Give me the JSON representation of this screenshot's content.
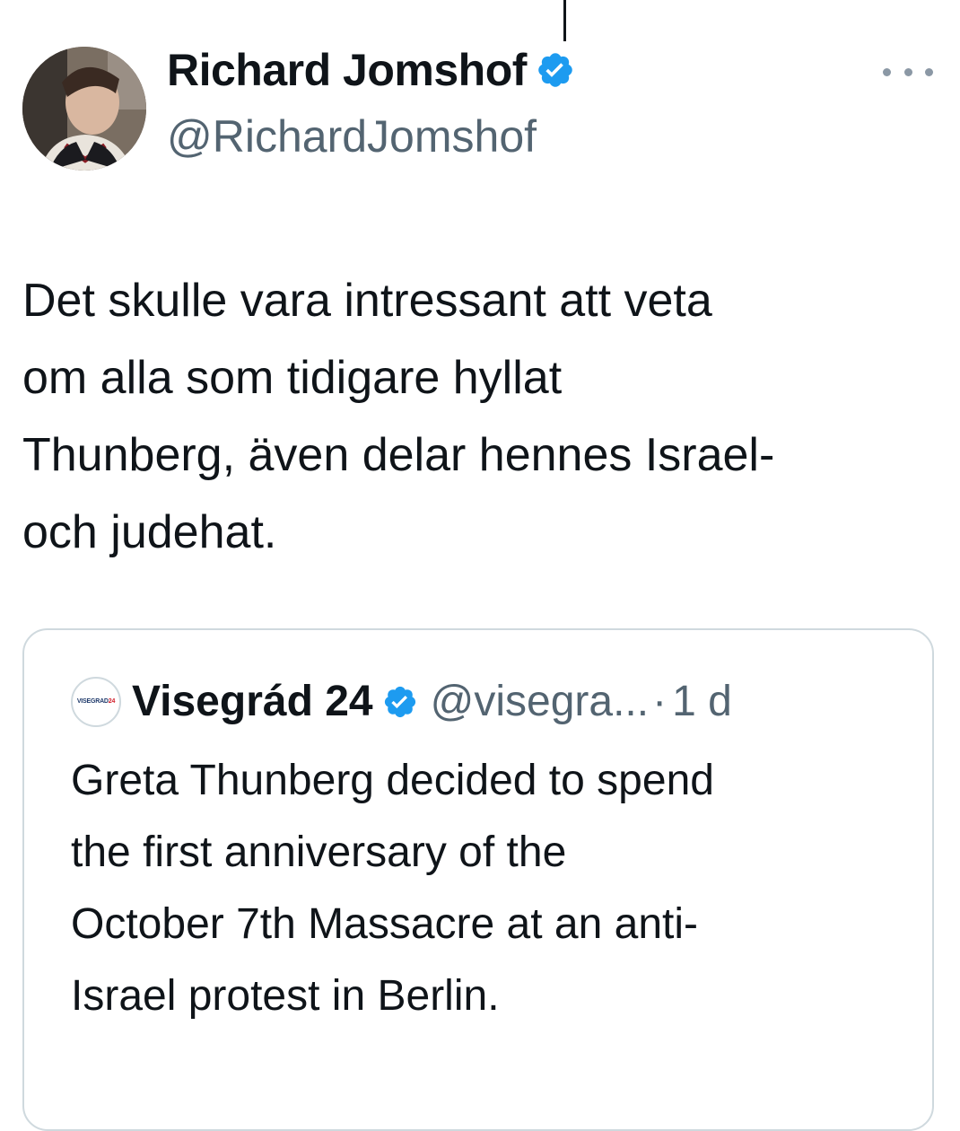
{
  "tweet": {
    "author": {
      "name": "Richard Jomshof",
      "handle": "@RichardJomshof",
      "verified": true,
      "verified_icon": "verified-badge-icon"
    },
    "more_icon": "more-options-icon",
    "text": "Det skulle vara intressant att veta\nom alla som tidigare hyllat\nThunberg, även delar hennes Israel-\noch judehat."
  },
  "quoted_tweet": {
    "avatar_label_part1": "VISEGRAD",
    "avatar_label_part2": "24",
    "author_name": "Visegrád 24",
    "verified": true,
    "handle": "@visegra...",
    "separator": "·",
    "time": "1 d",
    "text": "Greta Thunberg decided to spend\nthe first anniversary of the\nOctober 7th Massacre at an anti-\nIsrael protest in Berlin."
  },
  "colors": {
    "primary_text": "#0f1419",
    "secondary_text": "#536471",
    "verified_blue": "#1d9bf0",
    "card_border": "#cfd9de"
  }
}
